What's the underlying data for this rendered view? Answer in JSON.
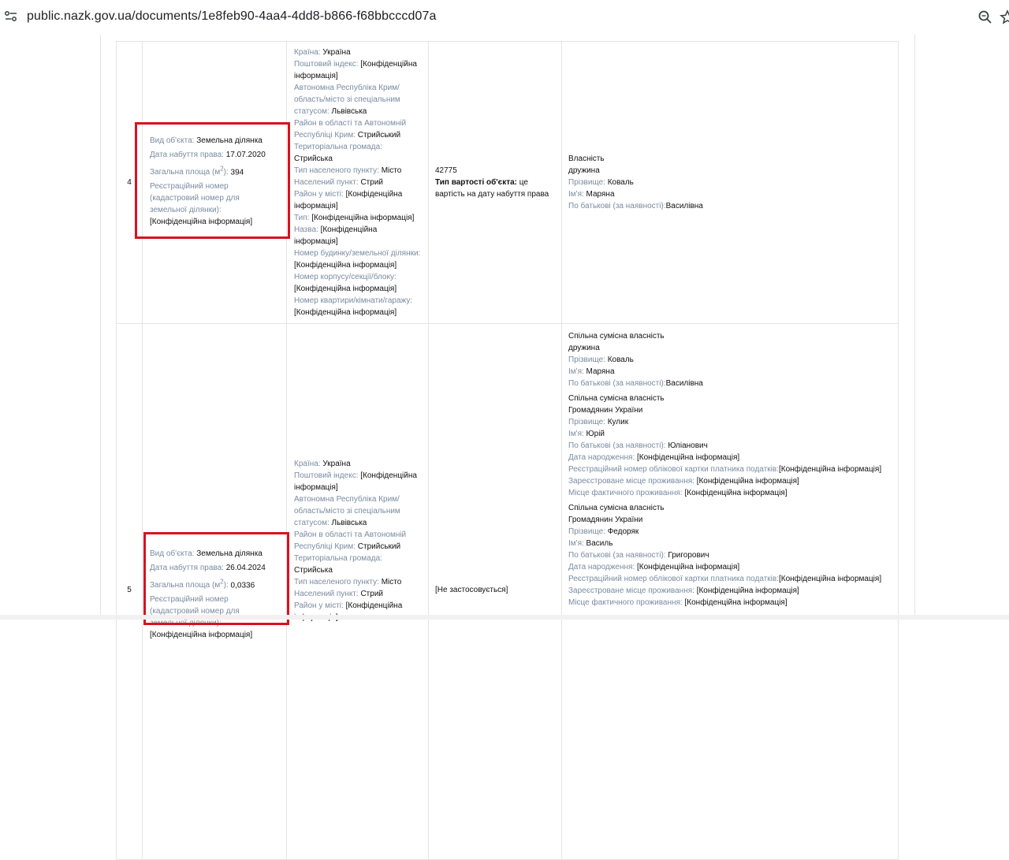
{
  "browser": {
    "url": "public.nazk.gov.ua/documents/1e8feb90-4aa4-4dd8-b866-f68bbcccd07a"
  },
  "rows": [
    {
      "num": "4",
      "object": {
        "type_label": "Вид об'єкта:",
        "type_value": "Земельна ділянка",
        "date_label": "Дата набуття права:",
        "date_value": "17.07.2020",
        "area_label": "Загальна площа (м",
        "area_sup": "2",
        "area_suffix": "):",
        "area_value": "394",
        "reg_label_1": "Реєстраційний номер",
        "reg_label_2": "(кадастровий номер для",
        "reg_label_3": "земельної ділянки):",
        "reg_value": "[Конфіденційна інформація]"
      },
      "address": [
        {
          "label": "Країна:",
          "value": "Україна"
        },
        {
          "label": "Поштовий індекс:",
          "value": "[Конфіденційна інформація]"
        },
        {
          "label": "Автономна Республіка Крим/ область/місто зі спеціальним статусом:",
          "value": "Львівська"
        },
        {
          "label": "Район в області та Автономній Республіці Крим:",
          "value": "Стрийський"
        },
        {
          "label": "Територіальна громада:",
          "value": "Стрийська"
        },
        {
          "label": "Тип населеного пункту:",
          "value": "Місто"
        },
        {
          "label": "Населений пункт:",
          "value": "Стрий"
        },
        {
          "label": "Район у місті:",
          "value": "[Конфіденційна інформація]"
        },
        {
          "label": "Тип:",
          "value": "[Конфіденційна інформація]"
        },
        {
          "label": "Назва:",
          "value": "[Конфіденційна інформація]"
        },
        {
          "label": "Номер будинку/земельної ділянки:",
          "value": "[Конфіденційна інформація]"
        },
        {
          "label": "Номер корпусу/секції/блоку:",
          "value": "[Конфіденційна інформація]"
        },
        {
          "label": "Номер квартири/кімнати/гаражу:",
          "value": "[Конфіденційна інформація]"
        }
      ],
      "value": {
        "amount": "42775",
        "type_label": "Тип вартості об'єкта:",
        "type_value": "це вартість на дату набуття права"
      },
      "owners": [
        {
          "right": "Власність",
          "relation": "дружина",
          "surname_label": "Прізвище:",
          "surname": "Коваль",
          "name_label": "Ім'я:",
          "name": "Маряна",
          "patronymic_label": "По батькові (за наявності):",
          "patronymic": "Василівна"
        }
      ]
    },
    {
      "num": "5",
      "object": {
        "type_label": "Вид об'єкта:",
        "type_value": "Земельна ділянка",
        "date_label": "Дата набуття права:",
        "date_value": "26.04.2024",
        "area_label": "Загальна площа (м",
        "area_sup": "2",
        "area_suffix": "):",
        "area_value": "0,0336",
        "reg_label_1": "Реєстраційний номер",
        "reg_label_2": "(кадастровий номер для",
        "reg_label_3": "земельної ділянки):",
        "reg_value": "[Конфіденційна інформація]"
      },
      "address": [
        {
          "label": "Країна:",
          "value": "Україна"
        },
        {
          "label": "Поштовий індекс:",
          "value": "[Конфіденційна інформація]"
        },
        {
          "label": "Автономна Республіка Крим/ область/місто зі спеціальним статусом:",
          "value": "Львівська"
        },
        {
          "label": "Район в області та Автономній Республіці Крим:",
          "value": "Стрийський"
        },
        {
          "label": "Територіальна громада:",
          "value": "Стрийська"
        },
        {
          "label": "Тип населеного пункту:",
          "value": "Місто"
        },
        {
          "label": "Населений пункт:",
          "value": "Стрий"
        },
        {
          "label": "Район у місті:",
          "value": "[Конфіденційна інформація]"
        }
      ],
      "value": {
        "not_applicable": "[Не застосовується]"
      },
      "owners": [
        {
          "right": "Спільна сумісна власність",
          "relation": "дружина",
          "surname_label": "Прізвище:",
          "surname": "Коваль",
          "name_label": "Ім'я:",
          "name": "Маряна",
          "patronymic_label": "По батькові (за наявності):",
          "patronymic": "Василівна"
        },
        {
          "right": "Спільна сумісна власність",
          "relation": "Громадянин України",
          "surname_label": "Прізвище:",
          "surname": "Кулик",
          "name_label": "Ім'я:",
          "name": "Юрій",
          "patronymic_label": "По батькові (за наявності):",
          "patronymic": "Юліанович",
          "birth_label": "Дата народження:",
          "birth": "[Конфіденційна інформація]",
          "tax_label": "Реєстраційний номер облікової картки платника податків:",
          "tax": "[Конфіденційна інформація]",
          "reg_place_label": "Зареєстроване місце проживання:",
          "reg_place": "[Конфіденційна інформація]",
          "actual_place_label": "Місце фактичного проживання:",
          "actual_place": "[Конфіденційна інформація]"
        },
        {
          "right": "Спільна сумісна власність",
          "relation": "Громадянин України",
          "surname_label": "Прізвище:",
          "surname": "Федоряк",
          "name_label": "Ім'я:",
          "name": "Василь",
          "patronymic_label": "По батькові (за наявності):",
          "patronymic": "Григорович",
          "birth_label": "Дата народження:",
          "birth": "[Конфіденційна інформація]",
          "tax_label": "Реєстраційний номер облікової картки платника податків:",
          "tax": "[Конфіденційна інформація]",
          "reg_place_label": "Зареєстроване місце проживання:",
          "reg_place": "[Конфіденційна інформація]",
          "actual_place_label": "Місце фактичного проживання:",
          "actual_place": "[Конфіденційна інформація]"
        }
      ]
    }
  ],
  "colors": {
    "highlight": "#d8121f",
    "label": "#7a8ba0"
  }
}
